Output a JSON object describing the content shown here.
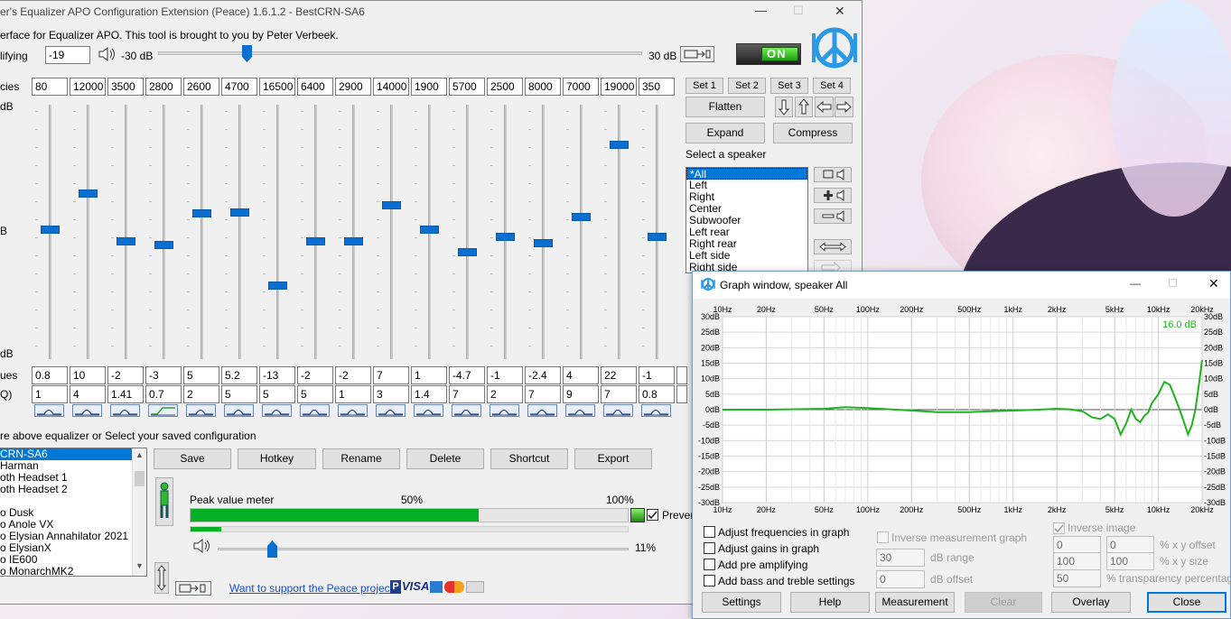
{
  "main_window": {
    "title": "er's Equalizer APO Configuration Extension (Peace) 1.6.1.2 - BestCRN-SA6",
    "intro": "erface for Equalizer APO. This tool is brought to you by Peter Verbeek.",
    "preamp_label": "lifying",
    "preamp_value": "-19",
    "range_min": "-30 dB",
    "range_max": "30 dB",
    "preamp_level_db": -19,
    "on_label": "ON",
    "minimize": "—",
    "maximize": "☐",
    "close": "✕"
  },
  "eq": {
    "freq_label": "cies",
    "top_db_label": "dB",
    "mid_db_label": "B",
    "bottom_db_label": "dB",
    "gain_label": "ues",
    "q_label": "Q)",
    "frequencies": [
      "80",
      "12000",
      "3500",
      "2800",
      "2600",
      "4700",
      "16500",
      "6400",
      "2900",
      "14000",
      "1900",
      "5700",
      "2500",
      "8000",
      "7000",
      "19000",
      "350"
    ],
    "gains": [
      "0.8",
      "10",
      "-2",
      "-3",
      "5",
      "5.2",
      "-13",
      "-2",
      "-2",
      "7",
      "1",
      "-4.7",
      "-1",
      "-2.4",
      "4",
      "22",
      "-1"
    ],
    "qs": [
      "1",
      "4",
      "1.41",
      "0.7",
      "2",
      "5",
      "5",
      "5",
      "1",
      "3",
      "1.4",
      "7",
      "2",
      "7",
      "9",
      "7",
      "0.8"
    ],
    "gain_values": [
      0.8,
      10,
      -2,
      -3,
      5,
      5.2,
      -13,
      -2,
      -2,
      7,
      1,
      -4.7,
      -1,
      -2.4,
      4,
      22,
      -1
    ],
    "filter_types": [
      "peak",
      "peak",
      "peak",
      "lowshelf",
      "peak",
      "peak",
      "peak",
      "peak",
      "peak",
      "peak",
      "peak",
      "peak",
      "peak",
      "peak",
      "peak",
      "peak",
      "peak"
    ]
  },
  "sets": {
    "set1": "Set 1",
    "set2": "Set 2",
    "set3": "Set 3",
    "set4": "Set 4",
    "flatten": "Flatten",
    "expand": "Expand",
    "compress": "Compress"
  },
  "speaker": {
    "label": "Select a speaker",
    "items": [
      "*All",
      "Left",
      "Right",
      "Center",
      "Subwoofer",
      "Left rear",
      "Right rear",
      "Left side",
      "Right side"
    ],
    "selected_index": 0
  },
  "config": {
    "header": "re above equalizer or Select your saved configuration",
    "items": [
      "CRN-SA6",
      "Harman",
      "oth Headset 1",
      "oth Headset 2",
      "",
      "o Dusk",
      "o Anole VX",
      "o Elysian Annahilator 2021",
      "o ElysianX",
      "o IE600",
      "o MonarchMK2"
    ],
    "selected_index": 0,
    "save": "Save",
    "hotkey": "Hotkey",
    "rename": "Rename",
    "delete": "Delete",
    "shortcut": "Shortcut",
    "export": "Export"
  },
  "meter": {
    "label": "Peak value meter",
    "p50": "50%",
    "p100": "100%",
    "level": 0.66,
    "level2": 0.07,
    "prevent": "Preven",
    "volume_pct": "11%",
    "volume_level": 0.11,
    "support_link": "Want to support the Peace project?",
    "visa": "VISA"
  },
  "graph": {
    "title": "Graph window, speaker All",
    "readout": "16.0 dB",
    "x_ticks": [
      "10Hz",
      "20Hz",
      "50Hz",
      "100Hz",
      "200Hz",
      "500Hz",
      "1kHz",
      "2kHz",
      "5kHz",
      "10kHz",
      "20kHz"
    ],
    "y_ticks": [
      "30dB",
      "25dB",
      "20dB",
      "15dB",
      "10dB",
      "5dB",
      "0dB",
      "-5dB",
      "-10dB",
      "-15dB",
      "-20dB",
      "-25dB",
      "-30dB"
    ],
    "adjust_freq": "Adjust frequencies in graph",
    "adjust_gain": "Adjust gains in graph",
    "add_pre": "Add pre amplifying",
    "add_bass": "Add bass and treble settings",
    "inverse_meas": "Inverse measurement graph",
    "db_range_value": "30",
    "db_range_label": "dB range",
    "db_offset_value": "0",
    "db_offset_label": "dB offset",
    "inverse_image": "Inverse image",
    "x_offset_value": "0",
    "y_offset_value": "0",
    "xy_offset_label": "% x y offset",
    "x_size_value": "100",
    "y_size_value": "100",
    "xy_size_label": "% x y size",
    "transp_value": "50",
    "transp_label": "% transparency percentage",
    "settings": "Settings",
    "help": "Help",
    "measurement": "Measurement",
    "clear": "Clear",
    "overlay": "Overlay",
    "close": "Close",
    "line_color": "#1fb31f",
    "readout_color": "#1fb31f"
  },
  "chart_data": {
    "type": "line",
    "xlabel": "",
    "ylabel": "",
    "x_scale": "log",
    "xlim": [
      10,
      20000
    ],
    "ylim": [
      -30,
      30
    ],
    "series": [
      {
        "x": [
          10,
          20,
          50,
          70,
          100,
          200,
          300,
          500,
          700,
          1000,
          1500,
          2000,
          2500,
          3000,
          3500,
          4000,
          4500,
          5000,
          5500,
          6000,
          6500,
          7000,
          7500,
          8000,
          8500,
          9000,
          10000,
          11000,
          12000,
          13000,
          14000,
          15000,
          16000,
          17000,
          18000,
          19000,
          20000
        ],
        "y": [
          0,
          0,
          0.3,
          0.8,
          0.5,
          -0.3,
          -0.8,
          -0.8,
          -0.5,
          -0.3,
          0,
          0.3,
          0.1,
          -0.5,
          -2.5,
          -3,
          -1.5,
          -3,
          -8,
          -4.5,
          0,
          -3,
          -4,
          -2,
          -1,
          2,
          5,
          9,
          8,
          4,
          0,
          -4,
          -8,
          -5,
          0,
          8,
          16
        ]
      }
    ]
  }
}
